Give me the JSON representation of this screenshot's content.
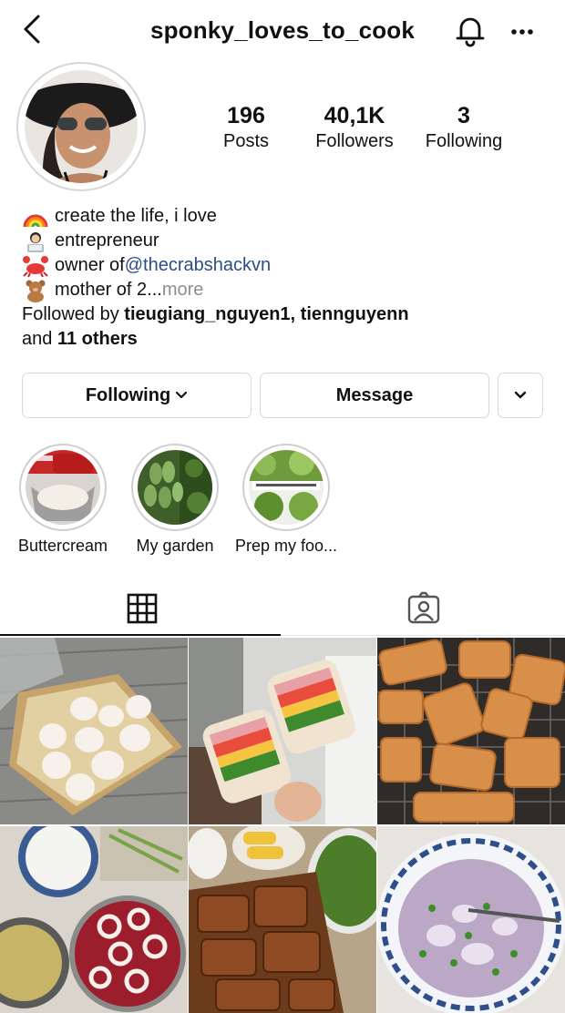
{
  "header": {
    "username": "sponky_loves_to_cook",
    "icons": {
      "back": "chevron-left-icon",
      "notifications": "bell-icon",
      "more": "more-horizontal-icon"
    }
  },
  "profile": {
    "stats": [
      {
        "value": "196",
        "label": "Posts"
      },
      {
        "value": "40,1K",
        "label": "Followers"
      },
      {
        "value": "3",
        "label": "Following"
      }
    ]
  },
  "bio": {
    "line1": "create the life, i love",
    "line2": "entrepreneur",
    "line3_prefix": "owner of ",
    "line3_mention": "@thecrabshackvn",
    "line4": "mother of 2...",
    "line4_more": " more",
    "followed_prefix": "Followed by ",
    "followed_user1": "tieugiang_nguyen1",
    "followed_sep": ", ",
    "followed_user2": "tiennguyenn",
    "followed_and": "and ",
    "followed_others": "11 others",
    "emojis": [
      "rainbow-emoji",
      "woman-technologist-emoji",
      "crab-emoji",
      "teddy-bear-emoji"
    ]
  },
  "actions": {
    "following_label": "Following",
    "message_label": "Message"
  },
  "highlights": [
    {
      "label": "Buttercream"
    },
    {
      "label": "My garden"
    },
    {
      "label": "Prep my foo..."
    }
  ],
  "tabs": {
    "grid": "grid-icon",
    "tagged": "tagged-person-icon",
    "active": "grid"
  },
  "colors": {
    "link": "#2b4d83",
    "muted": "#8e8e8e",
    "border": "#d8d8d8",
    "text": "#111111"
  }
}
